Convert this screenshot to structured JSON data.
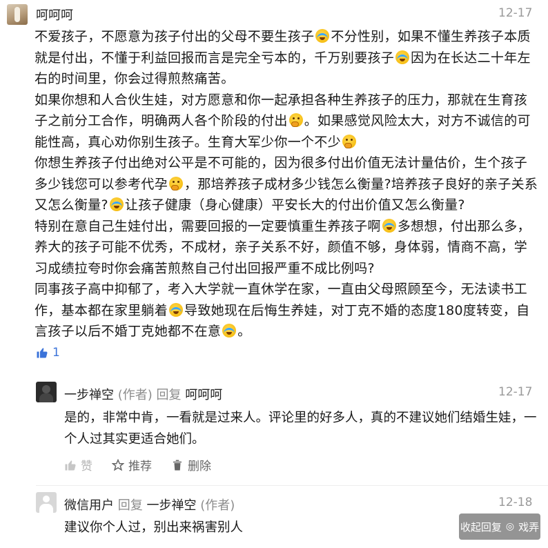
{
  "comment": {
    "author": "呵呵呵",
    "date": "12-17",
    "paragraphs": [
      [
        "不爱孩子，不愿意为孩子付出的父母不要生孩子",
        "cry",
        "不分性别，如果不懂生养孩子本质就是付出，不懂于利益回报而言是完全亏本的，千万别要孩子",
        "cry",
        "因为在长达二十年左右的时间里，你会过得煎熬痛苦。"
      ],
      [
        "如果你想和人合伙生娃，对方愿意和你一起承担各种生养孩子的压力，那就在生育孩子之前分工合作，明确两人各个阶段的付出",
        "think",
        "。如果感觉风险太大，对方不诚信的可能性高，真心劝你别生孩子。生育大军少你一个不少",
        "think"
      ],
      [
        "你想生养孩子付出绝对公平是不可能的，因为很多付出价值无法计量估价，生个孩子多少钱您可以参考代孕",
        "think",
        "，那培养孩子成材多少钱怎么衡量?培养孩子良好的亲子关系又怎么衡量?",
        "cry",
        "让孩子健康（身心健康）平安长大的付出价值又怎么衡量?"
      ],
      [
        "特别在意自己生娃付出，需要回报的一定要慎重生养孩子啊",
        "cry",
        "多想想，付出那么多，养大的孩子可能不优秀，不成材，亲子关系不好，颜值不够，身体弱，情商不高，学习成绩拉夸时你会痛苦煎熬自己付出回报严重不成比例吗?"
      ],
      [
        "同事孩子高中抑郁了，考入大学就一直休学在家，一直由父母照顾至今，无法读书工作，基本都在家里躺着",
        "cry",
        "导致她现在后悔生养娃，对丁克不婚的态度180度转变，自言孩子以后不婚丁克她都不在意",
        "cry",
        "。"
      ]
    ],
    "like_count": "1"
  },
  "replies": [
    {
      "author": "一步禅空",
      "author_tag": "(作者)",
      "reply_word": "回复",
      "reply_to": "呵呵呵",
      "date": "12-17",
      "text": "是的，非常中肯，一看就是过来人。评论里的好多人，真的不建议她们结婚生娃，一个人过其实更适合她们。",
      "actions": {
        "like": "赞",
        "recommend": "推荐",
        "delete": "删除"
      }
    },
    {
      "author": "微信用户",
      "reply_word": "回复",
      "reply_to": "一步禅空",
      "reply_to_tag": "(作者)",
      "date": "12-18",
      "text": "建议你个人过，别出来祸害别人"
    }
  ],
  "watermark": {
    "collapse_label": "收起回复",
    "brand": "戏弄"
  },
  "colors": {
    "like_blue": "#3b73d9",
    "meta_grey": "#8c8c8c",
    "date_grey": "#999999"
  }
}
